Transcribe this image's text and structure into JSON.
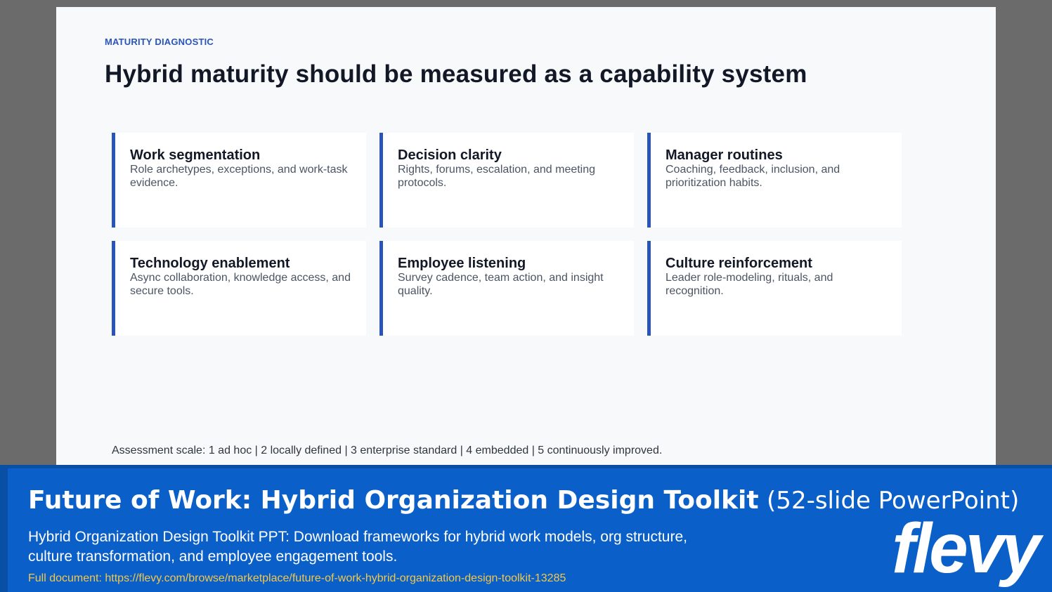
{
  "slide": {
    "eyebrow": "MATURITY DIAGNOSTIC",
    "title": "Hybrid maturity should be measured as a capability system",
    "cards": [
      {
        "title": "Work segmentation",
        "desc": "Role archetypes, exceptions, and work-task evidence."
      },
      {
        "title": "Decision clarity",
        "desc": "Rights, forums, escalation, and meeting protocols."
      },
      {
        "title": "Manager routines",
        "desc": "Coaching, feedback, inclusion, and prioritization habits."
      },
      {
        "title": "Technology enablement",
        "desc": "Async collaboration, knowledge access, and secure tools."
      },
      {
        "title": "Employee listening",
        "desc": "Survey cadence, team action, and insight quality."
      },
      {
        "title": "Culture reinforcement",
        "desc": "Leader role-modeling, rituals, and recognition."
      }
    ],
    "scale_note": "Assessment scale: 1 ad hoc | 2 locally defined | 3 enterprise standard | 4 embedded | 5 continuously improved."
  },
  "banner": {
    "title_strong": "Future of Work: Hybrid Organization Design Toolkit",
    "title_light": "(52-slide PowerPoint)",
    "description": "Hybrid Organization Design Toolkit PPT: Download frameworks for hybrid work models, org structure, culture transformation, and employee engagement tools.",
    "link": "Full document: https://flevy.com/browse/marketplace/future-of-work-hybrid-organization-design-toolkit-13285",
    "logo": "flevy"
  },
  "colors": {
    "accent": "#2a55b8",
    "banner": "#0a5fc8",
    "link": "#f2c84b"
  }
}
